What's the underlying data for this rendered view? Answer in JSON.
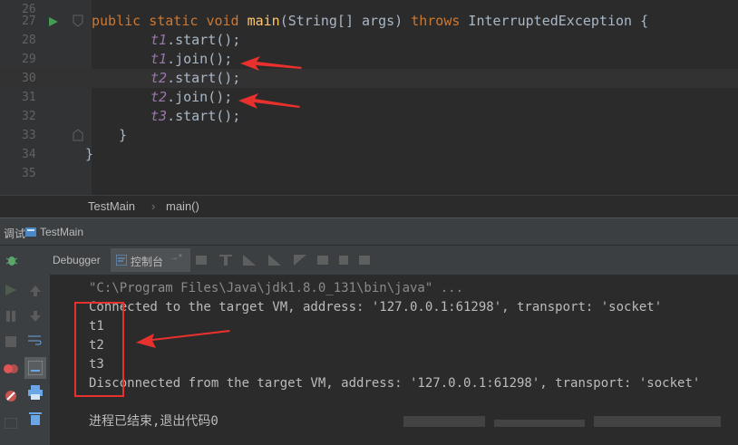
{
  "editor": {
    "lines": [
      {
        "num": "26",
        "text": ""
      },
      {
        "num": "27",
        "text": "public static void main(String[] args) throws InterruptedException {"
      },
      {
        "num": "28",
        "text": "t1.start();"
      },
      {
        "num": "29",
        "text": "t1.join();"
      },
      {
        "num": "30",
        "text": "t2.start();"
      },
      {
        "num": "31",
        "text": "t2.join();"
      },
      {
        "num": "32",
        "text": "t3.start();"
      },
      {
        "num": "33",
        "text": "}"
      },
      {
        "num": "34",
        "text": "}"
      },
      {
        "num": "35",
        "text": ""
      }
    ],
    "tokens": {
      "public": "public",
      "static": "static",
      "void": "void",
      "main": "main",
      "params": "(String[] args) ",
      "throws": "throws",
      "exc": " InterruptedException {",
      "t1": "t1",
      "t2": "t2",
      "t3": "t3",
      "start": ".start();",
      "join": ".join();"
    }
  },
  "breadcrumb": {
    "class_name": "TestMain",
    "separator": "›",
    "method": "main()"
  },
  "debug_panel": {
    "tab_label": "调试",
    "config": "TestMain"
  },
  "toolbar": {
    "debugger_tab": "Debugger",
    "console_tab": "控制台",
    "pin": "→*"
  },
  "console": {
    "lines": [
      "\"C:\\Program Files\\Java\\jdk1.8.0_131\\bin\\java\" ...",
      "Connected to the target VM, address: '127.0.0.1:61298', transport: 'socket'",
      "t1",
      "t2",
      "t3",
      "Disconnected from the target VM, address: '127.0.0.1:61298', transport: 'socket'",
      "",
      "进程已结束,退出代码0"
    ]
  },
  "colors": {
    "annotation": "#e8312c",
    "keyword": "#cc7832",
    "method": "#ffc66d",
    "field": "#9876aa"
  },
  "icons": [
    "run-icon",
    "bookmark-icon",
    "bug-icon",
    "resume-icon",
    "pause-icon",
    "stop-icon",
    "breakpoints-icon",
    "mute-icon",
    "camera-icon",
    "settings-icon",
    "up-icon",
    "down-icon",
    "soft-wrap-icon",
    "scroll-end-icon",
    "print-icon",
    "trash-icon"
  ]
}
